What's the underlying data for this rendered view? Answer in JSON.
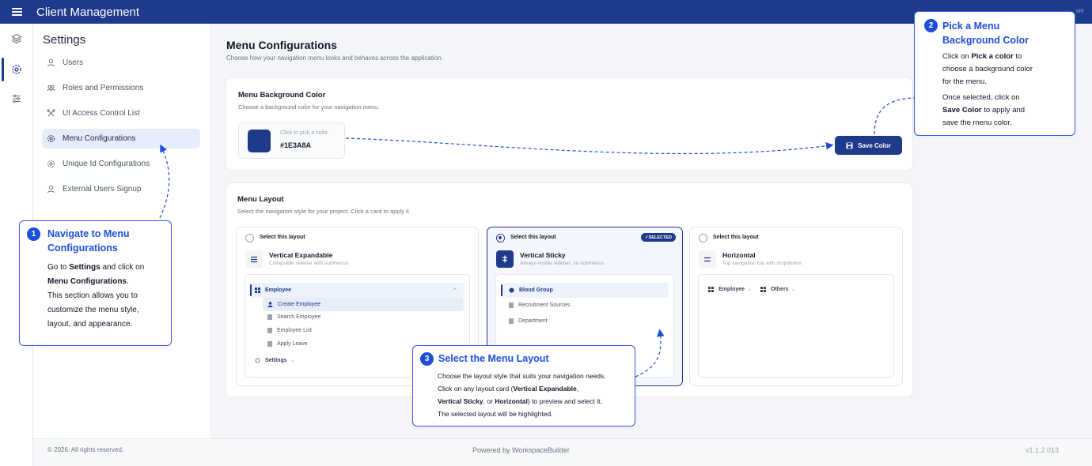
{
  "app": {
    "title": "Client Management",
    "user_text": "we"
  },
  "sidebar": {
    "title": "Settings",
    "items": [
      {
        "label": "Users",
        "icon": "user-icon"
      },
      {
        "label": "Roles and Permissions",
        "icon": "roles-icon"
      },
      {
        "label": "UI Access Control List",
        "icon": "tools-icon"
      },
      {
        "label": "Menu Configurations",
        "icon": "gear-icon",
        "active": true
      },
      {
        "label": "Unique Id Configurations",
        "icon": "gear-icon"
      },
      {
        "label": "External Users Signup",
        "icon": "user-icon"
      }
    ]
  },
  "page": {
    "title": "Menu Configurations",
    "subtitle": "Choose how your navigation menu looks and behaves across the application."
  },
  "bg_color_card": {
    "title": "Menu Background Color",
    "subtitle": "Choose a background color for your navigation menu.",
    "picker_hint": "Click to pick a color",
    "value": "#1E3A8A",
    "save_label": "Save Color"
  },
  "layout_card": {
    "title": "Menu Layout",
    "subtitle": "Select the navigation style for your project. Click a card to apply it.",
    "options": [
      {
        "select_text": "Select this layout",
        "name": "Vertical Expandable",
        "desc": "Collapsible sidebar with submenus",
        "preview": {
          "group": "Employee",
          "items": [
            "Create Employee",
            "Search Employee",
            "Employee List",
            "Apply Leave"
          ],
          "footer_group": "Settings"
        }
      },
      {
        "select_text": "Select this layout",
        "badge": "✓SELECTED",
        "name": "Vertical Sticky",
        "desc": "Always-visible sidebar, no submenus",
        "preview": {
          "items": [
            "Blood Group",
            "Recruitment Sources",
            "Department"
          ]
        }
      },
      {
        "select_text": "Select this layout",
        "name": "Horizontal",
        "desc": "Top navigation bar with dropdowns",
        "preview": {
          "items": [
            "Employee",
            "Others"
          ]
        }
      }
    ]
  },
  "callouts": {
    "one": {
      "num": "1",
      "title_l1": "Navigate to Menu",
      "title_l2": "Configurations",
      "b1": "Go to ",
      "b1b": "Settings",
      "b1c": " and click on",
      "b2b": "Menu Configurations",
      "b2c": ".",
      "b3": "This section allows you to",
      "b4": "customize the menu style,",
      "b5": "layout, and appearance."
    },
    "two": {
      "num": "2",
      "title_l1": "Pick a Menu",
      "title_l2": "Background Color",
      "b1": "Click on ",
      "b1b": "Pick a color",
      "b1c": " to",
      "b2": "choose a background color",
      "b3": "for the menu.",
      "b4": "Once selected, click on",
      "b5b": "Save Color",
      "b5c": " to apply and",
      "b6": "save the menu color."
    },
    "three": {
      "num": "3",
      "title": "Select the Menu Layout",
      "b1": "Choose the layout style that suits your navigation needs.",
      "b2": "Click on any layout card (",
      "b2b": "Vertical Expandable",
      "b2c": ",",
      "b3b1": "Vertical Sticky",
      "b3c": ", or ",
      "b3b2": "Horizontal",
      "b3d": ") to preview and select it.",
      "b4": "The selected layout will be highlighted."
    }
  },
  "footer": {
    "copyright": "© 2026. All rights reserved.",
    "powered": "Powered by WorkspaceBuilder",
    "version": "v1.1.2.013"
  },
  "colors": {
    "brand": "#1E3A8A",
    "accent": "#1d4ed8"
  }
}
